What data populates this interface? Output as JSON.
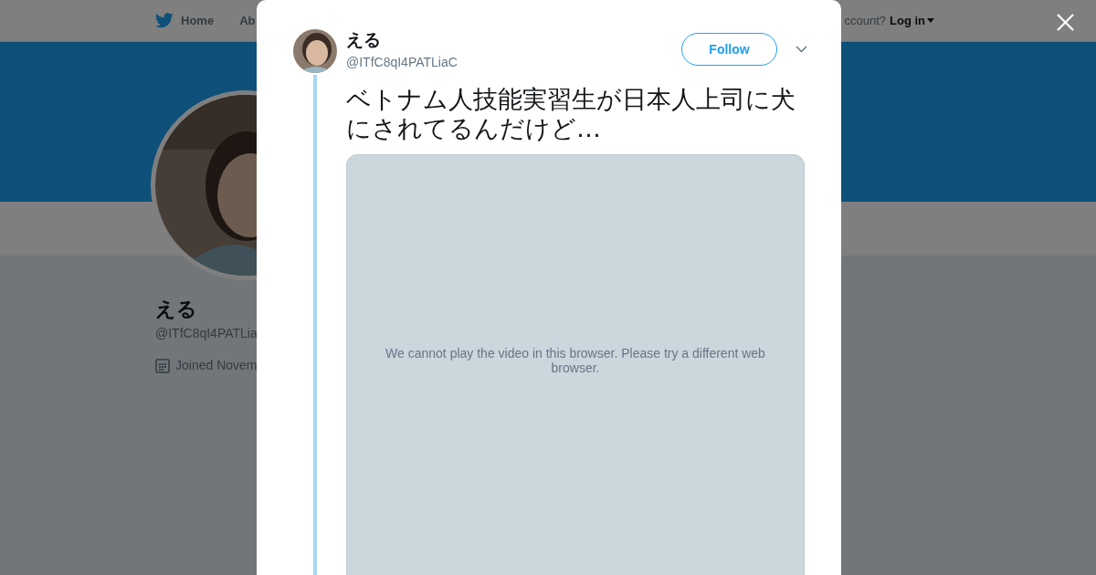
{
  "background_page": {
    "nav": {
      "items": [
        {
          "label": "Home"
        },
        {
          "label": "Ab"
        }
      ],
      "signup_prompt": "ccount?",
      "login": "Log in"
    },
    "profile": {
      "name": "える",
      "handle": "@ITfC8qI4PATLia",
      "joined": "Joined Novem"
    }
  },
  "modal": {
    "tweet": {
      "author": {
        "name": "える",
        "handle": "@ITfC8qI4PATLiaC"
      },
      "follow_button": "Follow",
      "text": "ベトナム人技能実習生が日本人上司に犬にされてるんだけど…",
      "video": {
        "message": "We cannot play the video in this browser. Please try a different web browser."
      }
    }
  }
}
